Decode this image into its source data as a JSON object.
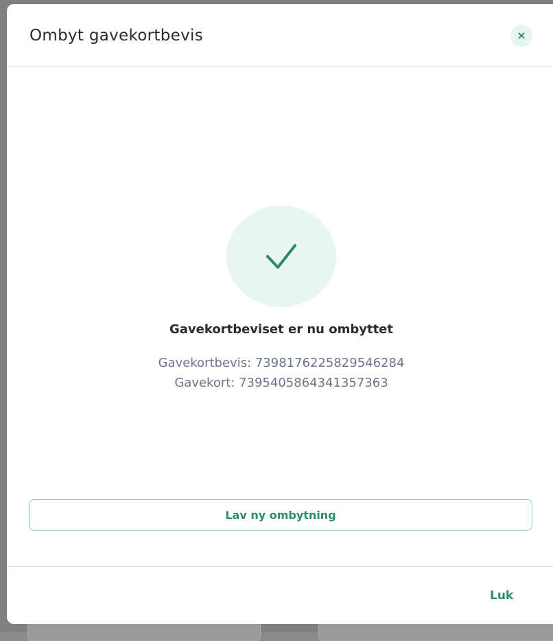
{
  "modal": {
    "title": "Ombyt gavekortbevis",
    "close_icon": "×"
  },
  "success": {
    "icon": "checkmark-icon",
    "title": "Gavekortbeviset er nu ombyttet",
    "voucher_line": "Gavekortbevis: 7398176225829546284",
    "giftcard_line": "Gavekort: 7395405864341357363"
  },
  "actions": {
    "new_exchange_label": "Lav ny ombytning",
    "close_label": "Luk"
  },
  "colors": {
    "accent": "#2c8a66",
    "accent_light": "#e9f5f0",
    "text_dark": "#2a2a33",
    "text_muted": "#6b7589"
  }
}
